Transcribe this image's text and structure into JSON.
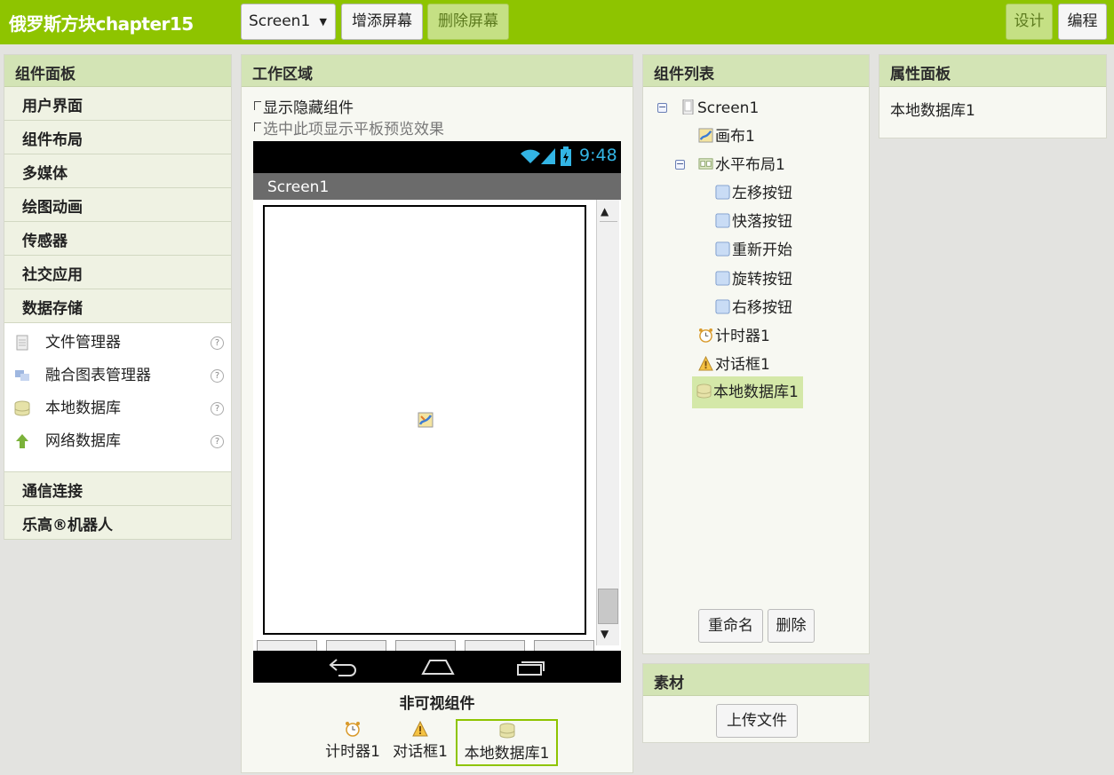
{
  "topbar": {
    "title": "俄罗斯方块chapter15",
    "screen_select": "Screen1",
    "add_screen": "增添屏幕",
    "remove_screen": "删除屏幕",
    "design": "设计",
    "blocks": "编程"
  },
  "palette": {
    "title": "组件面板",
    "categories_top": [
      "用户界面",
      "组件布局",
      "多媒体",
      "绘图动画",
      "传感器",
      "社交应用",
      "数据存储"
    ],
    "items": [
      "文件管理器",
      "融合图表管理器",
      "本地数据库",
      "网络数据库"
    ],
    "categories_bottom": [
      "通信连接",
      "乐高®机器人"
    ],
    "help_glyph": "?"
  },
  "viewer": {
    "title": "工作区域",
    "show_hidden": "显示隐藏组件",
    "tablet_preview": "选中此项显示平板预览效果",
    "clock": "9:48",
    "screen_title": "Screen1",
    "nonvisible_title": "非可视组件",
    "nonvisible": [
      "计时器1",
      "对话框1",
      "本地数据库1"
    ]
  },
  "tree": {
    "title": "组件列表",
    "toggle_glyph": "−",
    "nodes": [
      "Screen1",
      "画布1",
      "水平布局1",
      "左移按钮",
      "快落按钮",
      "重新开始",
      "旋转按钮",
      "右移按钮",
      "计时器1",
      "对话框1",
      "本地数据库1"
    ],
    "rename": "重命名",
    "delete": "删除"
  },
  "media": {
    "title": "素材",
    "upload": "上传文件"
  },
  "properties": {
    "title": "属性面板",
    "selected": "本地数据库1"
  },
  "colors": {
    "accent": "#8ec400",
    "selected_row": "#d4e8a8",
    "phone_status": "#000000",
    "phone_title": "#6b6b6b",
    "wifi_icon": "#33b5e5"
  }
}
